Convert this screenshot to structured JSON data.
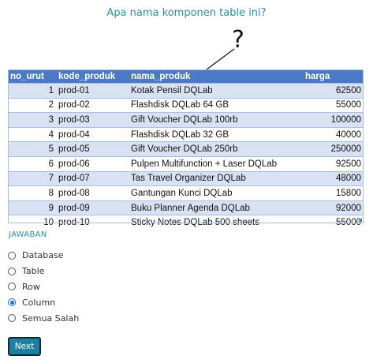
{
  "question": "Apa nama komponen table ini?",
  "annotation": {
    "symbol": "?"
  },
  "table": {
    "headers": [
      "no_urut",
      "kode_produk",
      "nama_produk",
      "harga"
    ],
    "rows": [
      [
        "1",
        "prod-01",
        "Kotak Pensil DQLab",
        "62500"
      ],
      [
        "2",
        "prod-02",
        "Flashdisk DQLab 64 GB",
        "55000"
      ],
      [
        "3",
        "prod-03",
        "Gift Voucher DQLab 100rb",
        "100000"
      ],
      [
        "4",
        "prod-04",
        "Flashdisk DQLab 32 GB",
        "40000"
      ],
      [
        "5",
        "prod-05",
        "Gift Voucher DQLab 250rb",
        "250000"
      ],
      [
        "6",
        "prod-06",
        "Pulpen Multifunction + Laser DQLab",
        "92500"
      ],
      [
        "7",
        "prod-07",
        "Tas Travel Organizer DQLab",
        "48000"
      ],
      [
        "8",
        "prod-08",
        "Gantungan Kunci DQLab",
        "15800"
      ],
      [
        "9",
        "prod-09",
        "Buku Planner Agenda DQLab",
        "92000"
      ],
      [
        "10",
        "prod-10",
        "Sticky Notes DQLab 500 sheets",
        "55000"
      ]
    ]
  },
  "answer_section": {
    "label": "JAWABAN",
    "options": [
      {
        "label": "Database",
        "selected": false
      },
      {
        "label": "Table",
        "selected": false
      },
      {
        "label": "Row",
        "selected": false
      },
      {
        "label": "Column",
        "selected": true
      },
      {
        "label": "Semua Salah",
        "selected": false
      }
    ]
  },
  "next_button": {
    "label": "Next"
  },
  "colors": {
    "accent": "#2a8ea8",
    "table_header": "#4c79c6",
    "table_row_alt": "#d8e2f3",
    "radio_selected": "#1a73e8",
    "button": "#1f7fa0"
  }
}
